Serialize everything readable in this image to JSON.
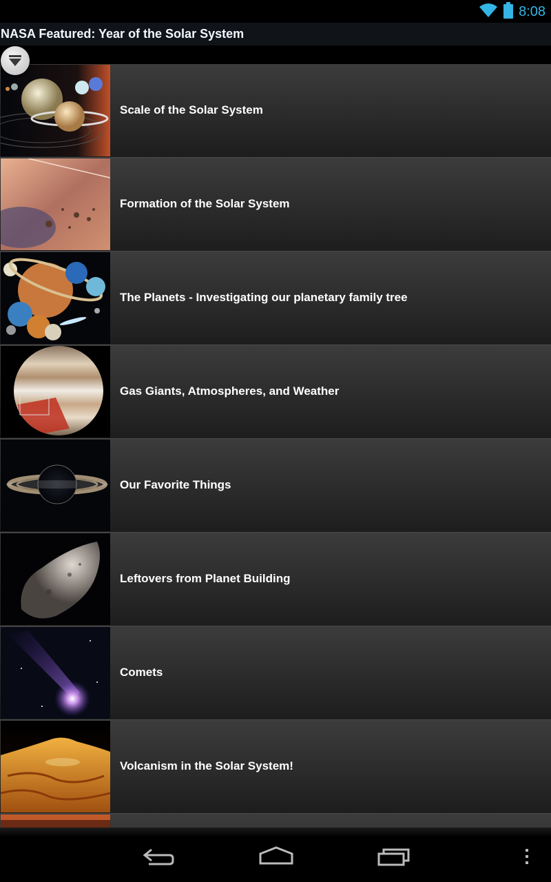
{
  "status_bar": {
    "time": "8:08",
    "wifi_icon": "wifi-icon",
    "battery_icon": "battery-icon",
    "accent_color": "#33b5e5"
  },
  "title_bar": {
    "title": "NASA Featured: Year of the Solar System",
    "filter_icon": "filter-icon"
  },
  "items": [
    {
      "title": "Scale of the Solar System"
    },
    {
      "title": "Formation of the Solar System"
    },
    {
      "title": "The Planets - Investigating our planetary family tree"
    },
    {
      "title": "Gas Giants, Atmospheres, and Weather"
    },
    {
      "title": "Our Favorite Things"
    },
    {
      "title": "Leftovers from Planet Building"
    },
    {
      "title": "Comets"
    },
    {
      "title": "Volcanism in the Solar System!"
    }
  ],
  "nav_bar": {
    "back_icon": "back-icon",
    "home_icon": "home-icon",
    "recents_icon": "recent-apps-icon",
    "menu_icon": "overflow-menu-icon"
  }
}
